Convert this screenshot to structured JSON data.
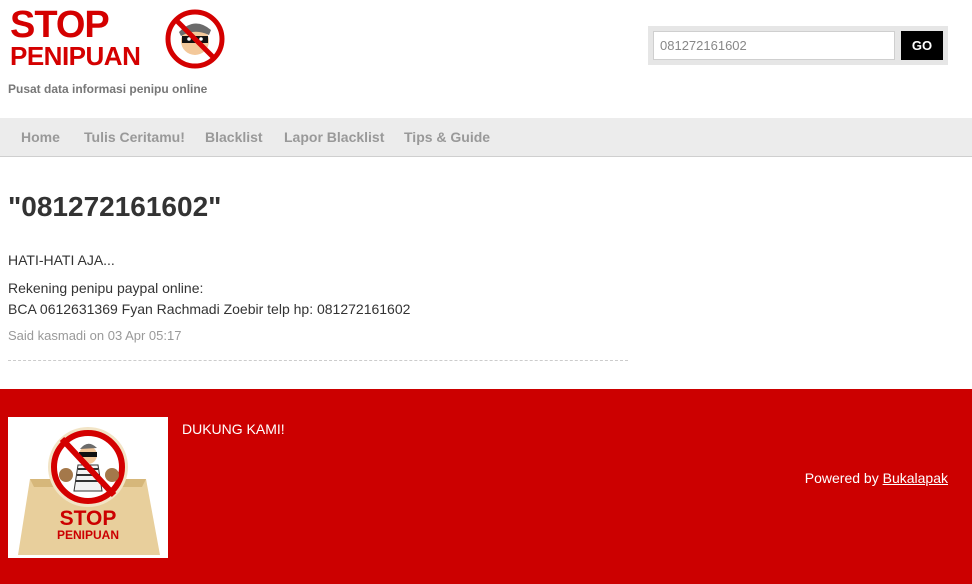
{
  "header": {
    "logo_line1": "STOP",
    "logo_line2": "PENIPUAN",
    "tagline": "Pusat data informasi penipu online"
  },
  "search": {
    "value": "081272161602",
    "button_label": "GO"
  },
  "nav": {
    "items": [
      {
        "label": "Home"
      },
      {
        "label": "Tulis Ceritamu!"
      },
      {
        "label": "Blacklist"
      },
      {
        "label": "Lapor Blacklist"
      },
      {
        "label": "Tips & Guide"
      }
    ]
  },
  "main": {
    "title": "\"081272161602\"",
    "line1": "HATI-HATI AJA...",
    "line2": "Rekening penipu paypal online:",
    "line3": "BCA 0612631369 Fyan Rachmadi Zoebir telp hp: 081272161602",
    "meta": "Said kasmadi on 03 Apr 05:17"
  },
  "footer": {
    "badge_line1": "STOP",
    "badge_line2": "PENIPUAN",
    "heading": "DUKUNG KAMI!",
    "powered_prefix": "Powered by ",
    "powered_link": "Bukalapak"
  },
  "colors": {
    "brand_red": "#cc0000",
    "logo_red": "#d40000",
    "nav_bg": "#ececec"
  },
  "icons": [
    "thief-prohibited-icon",
    "stop-penipuan-badge"
  ]
}
